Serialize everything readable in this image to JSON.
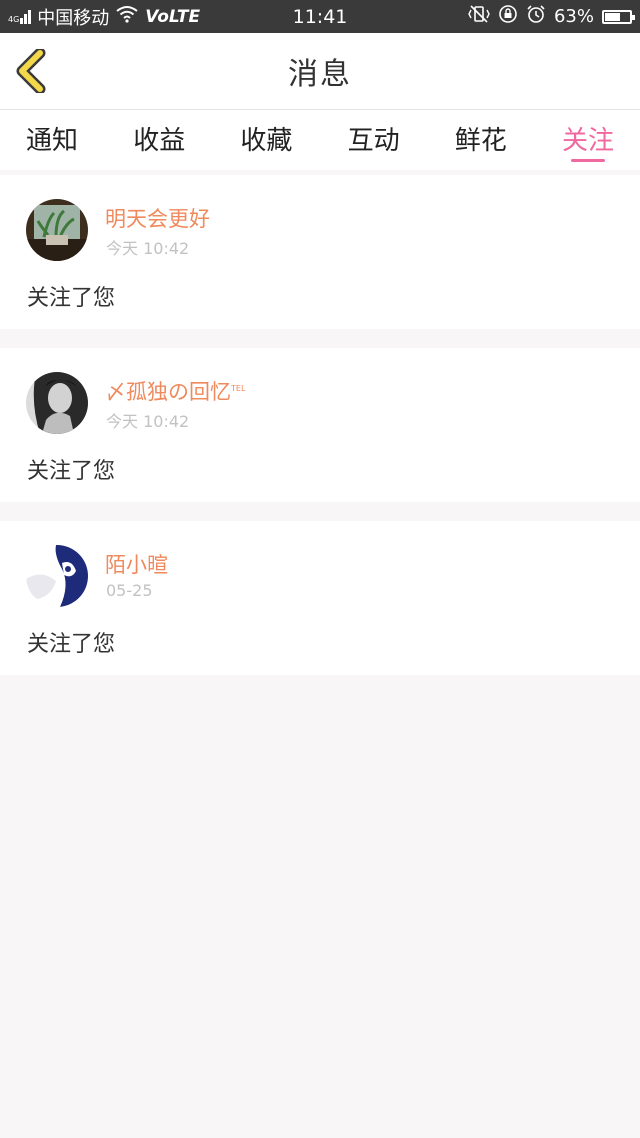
{
  "status_bar": {
    "signal_prefix": "4G",
    "carrier": "中国移动",
    "network": "VoLTE",
    "time": "11:41",
    "battery_percent": "63%",
    "battery_level": 0.63
  },
  "header": {
    "title": "消息"
  },
  "tabs": [
    {
      "label": "通知",
      "active": false
    },
    {
      "label": "收益",
      "active": false
    },
    {
      "label": "收藏",
      "active": false
    },
    {
      "label": "互动",
      "active": false
    },
    {
      "label": "鲜花",
      "active": false
    },
    {
      "label": "关注",
      "active": true
    }
  ],
  "messages": [
    {
      "name": "明天会更好",
      "time": "今天 10:42",
      "text": "关注了您"
    },
    {
      "name": "〆孤独の回忆",
      "name_suffix": "TEL",
      "time": "今天 10:42",
      "text": "关注了您"
    },
    {
      "name": "陌小暄",
      "time": "05-25",
      "text": "关注了您"
    }
  ],
  "colors": {
    "accent": "#f0689f",
    "name": "#ef8a5e",
    "back_arrow": "#f5d84a"
  }
}
